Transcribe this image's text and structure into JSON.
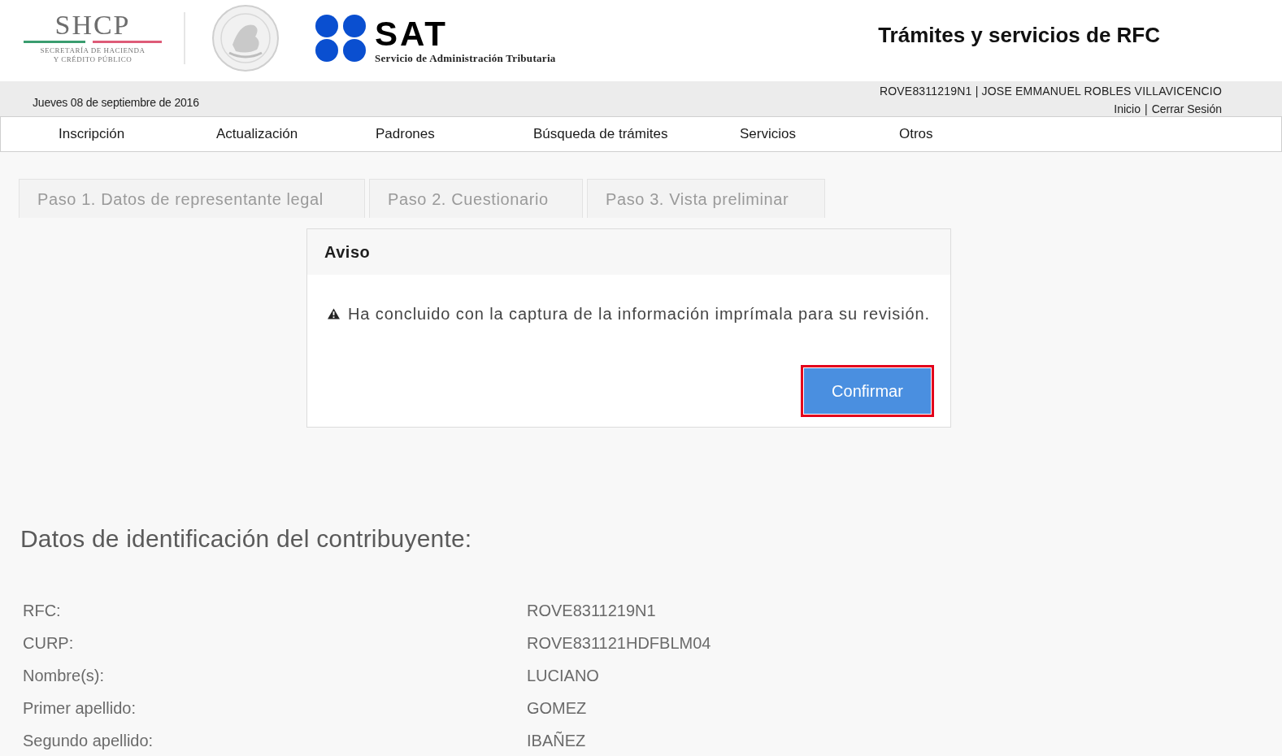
{
  "header": {
    "shcp_logo": {
      "wordmark": "SHCP",
      "subtitle_lines": [
        "SECRETARÍA DE HACIENDA",
        "Y CRÉDITO PÚBLICO"
      ]
    },
    "sat_logo": {
      "wordmark": "SAT",
      "subtitle": "Servicio de Administración Tributaria"
    },
    "title": "Trámites y servicios de RFC"
  },
  "info_bar": {
    "date": "Jueves 08 de septiembre de 2016",
    "user": "ROVE8311219N1 | JOSE EMMANUEL ROBLES VILLAVICENCIO",
    "links": [
      "Inicio",
      "Cerrar Sesión"
    ],
    "link_separator": "|"
  },
  "nav": [
    "Inscripción",
    "Actualización",
    "Padrones",
    "Búsqueda de trámites",
    "Servicios",
    "Otros"
  ],
  "steps": [
    {
      "label": "Paso 1. Datos de representante legal",
      "selected": false
    },
    {
      "label": "Paso 2. Cuestionario",
      "selected": false
    },
    {
      "label": "Paso 3. Vista preliminar",
      "selected": false
    }
  ],
  "dialog": {
    "title": "Aviso",
    "message": "Ha concluido con la captura de la información imprímala para su revisión.",
    "button": {
      "label": "Confirmar",
      "highlighted": true
    }
  },
  "taxpayer": {
    "heading": "Datos de identificación del contribuyente:",
    "fields": [
      {
        "label": "RFC:",
        "value": "ROVE8311219N1"
      },
      {
        "label": "CURP:",
        "value": "ROVE831121HDFBLM04"
      },
      {
        "label": "Nombre(s):",
        "value": "LUCIANO"
      },
      {
        "label": "Primer apellido:",
        "value": "GOMEZ"
      },
      {
        "label": "Segundo apellido:",
        "value": "IBAÑEZ"
      }
    ]
  }
}
